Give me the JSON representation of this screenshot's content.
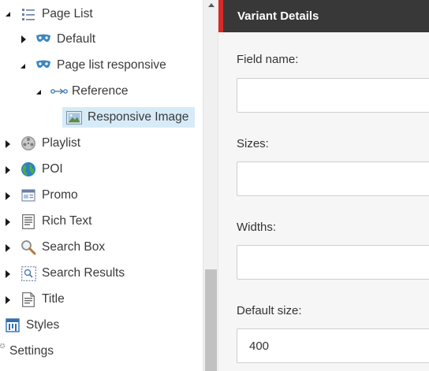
{
  "tree": {
    "items": [
      {
        "label": "Page List",
        "icon": "page-list-icon",
        "expanded": true
      },
      {
        "label": "Default",
        "icon": "variant-mask-icon",
        "expanded": false
      },
      {
        "label": "Page list responsive",
        "icon": "variant-mask-icon",
        "expanded": true
      },
      {
        "label": "Reference",
        "icon": "reference-link-icon",
        "expanded": true
      },
      {
        "label": "Responsive Image",
        "icon": "responsive-image-icon",
        "selected": true
      },
      {
        "label": "Playlist",
        "icon": "film-reel-icon",
        "expanded": false
      },
      {
        "label": "POI",
        "icon": "globe-icon",
        "expanded": false
      },
      {
        "label": "Promo",
        "icon": "promo-icon",
        "expanded": false
      },
      {
        "label": "Rich Text",
        "icon": "rich-text-icon",
        "expanded": false
      },
      {
        "label": "Search Box",
        "icon": "search-icon",
        "expanded": false
      },
      {
        "label": "Search Results",
        "icon": "search-results-icon",
        "expanded": false
      },
      {
        "label": "Title",
        "icon": "title-document-icon",
        "expanded": false
      },
      {
        "label": "Styles",
        "icon": "styles-icon"
      },
      {
        "label": "Settings",
        "icon": "settings-icon"
      }
    ]
  },
  "details": {
    "title": "Variant Details",
    "accent_color": "#d52a27",
    "fields": [
      {
        "label": "Field name:",
        "value": ""
      },
      {
        "label": "Sizes:",
        "value": ""
      },
      {
        "label": "Widths:",
        "value": ""
      },
      {
        "label": "Default size:",
        "value": "400"
      }
    ]
  }
}
